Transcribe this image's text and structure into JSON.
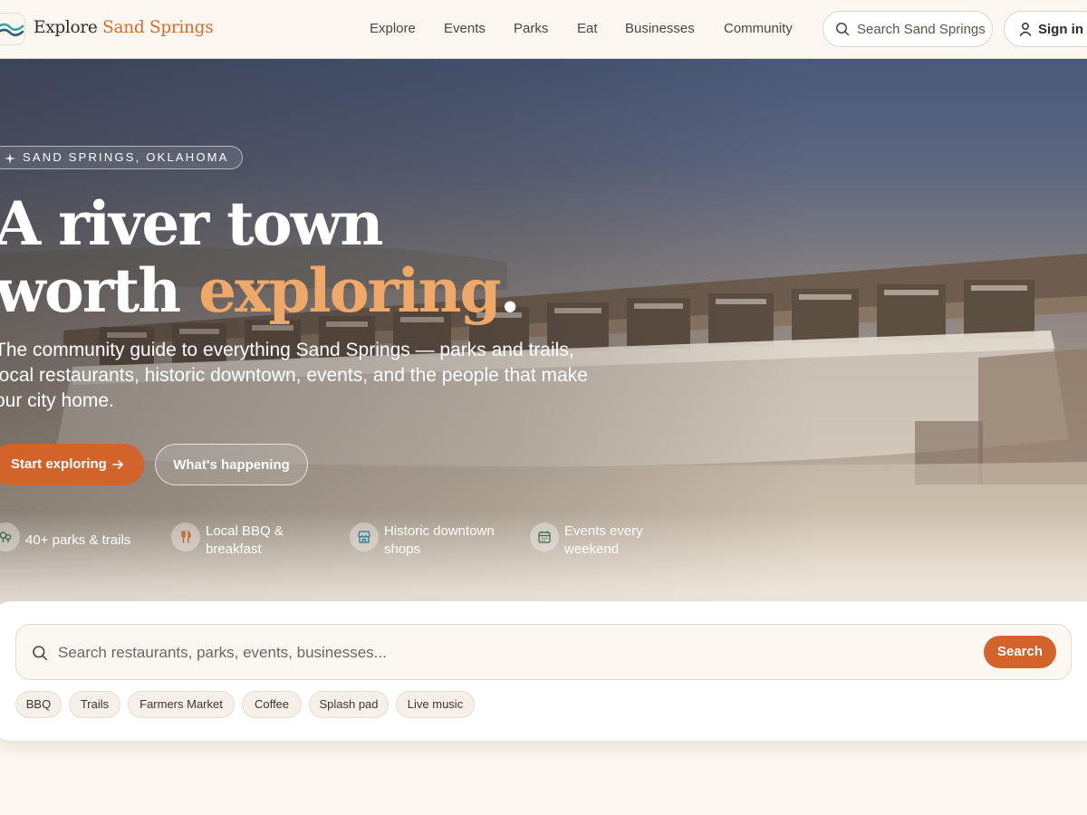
{
  "brand": {
    "name_part1": "Explore",
    "name_part2": "Sand Springs"
  },
  "nav": {
    "items": [
      {
        "label": "Explore"
      },
      {
        "label": "Events"
      },
      {
        "label": "Parks"
      },
      {
        "label": "Eat"
      },
      {
        "label": "Businesses"
      },
      {
        "label": "Community"
      }
    ]
  },
  "header": {
    "search_placeholder": "Search Sand Springs",
    "signin_label": "Sign in"
  },
  "hero": {
    "eyebrow": "SAND SPRINGS, OKLAHOMA",
    "headline_line1": "A river town",
    "headline_line2_prefix": "worth ",
    "headline_line2_accent": "exploring",
    "headline_line2_suffix": ".",
    "lede": "The community guide to everything Sand Springs — parks and trails, local restaurants, historic downtown, events, and the people that make our city home.",
    "primary_cta": "Start exploring",
    "secondary_cta": "What's happening",
    "features": [
      {
        "icon": "trees-icon",
        "label": "40+ parks & trails"
      },
      {
        "icon": "utensils-icon",
        "label": "Local BBQ & breakfast"
      },
      {
        "icon": "storefront-icon",
        "label": "Historic downtown shops"
      },
      {
        "icon": "calendar-icon",
        "label": "Events every weekend"
      }
    ]
  },
  "search": {
    "placeholder": "Search restaurants, parks, events, businesses...",
    "button": "Search",
    "chips": [
      "BBQ",
      "Trails",
      "Farmers Market",
      "Coffee",
      "Splash pad",
      "Live music"
    ]
  },
  "colors": {
    "accent": "#d2632b",
    "accent_light": "#f0a868",
    "background": "#fcf8f1",
    "text": "#2f2a25"
  }
}
